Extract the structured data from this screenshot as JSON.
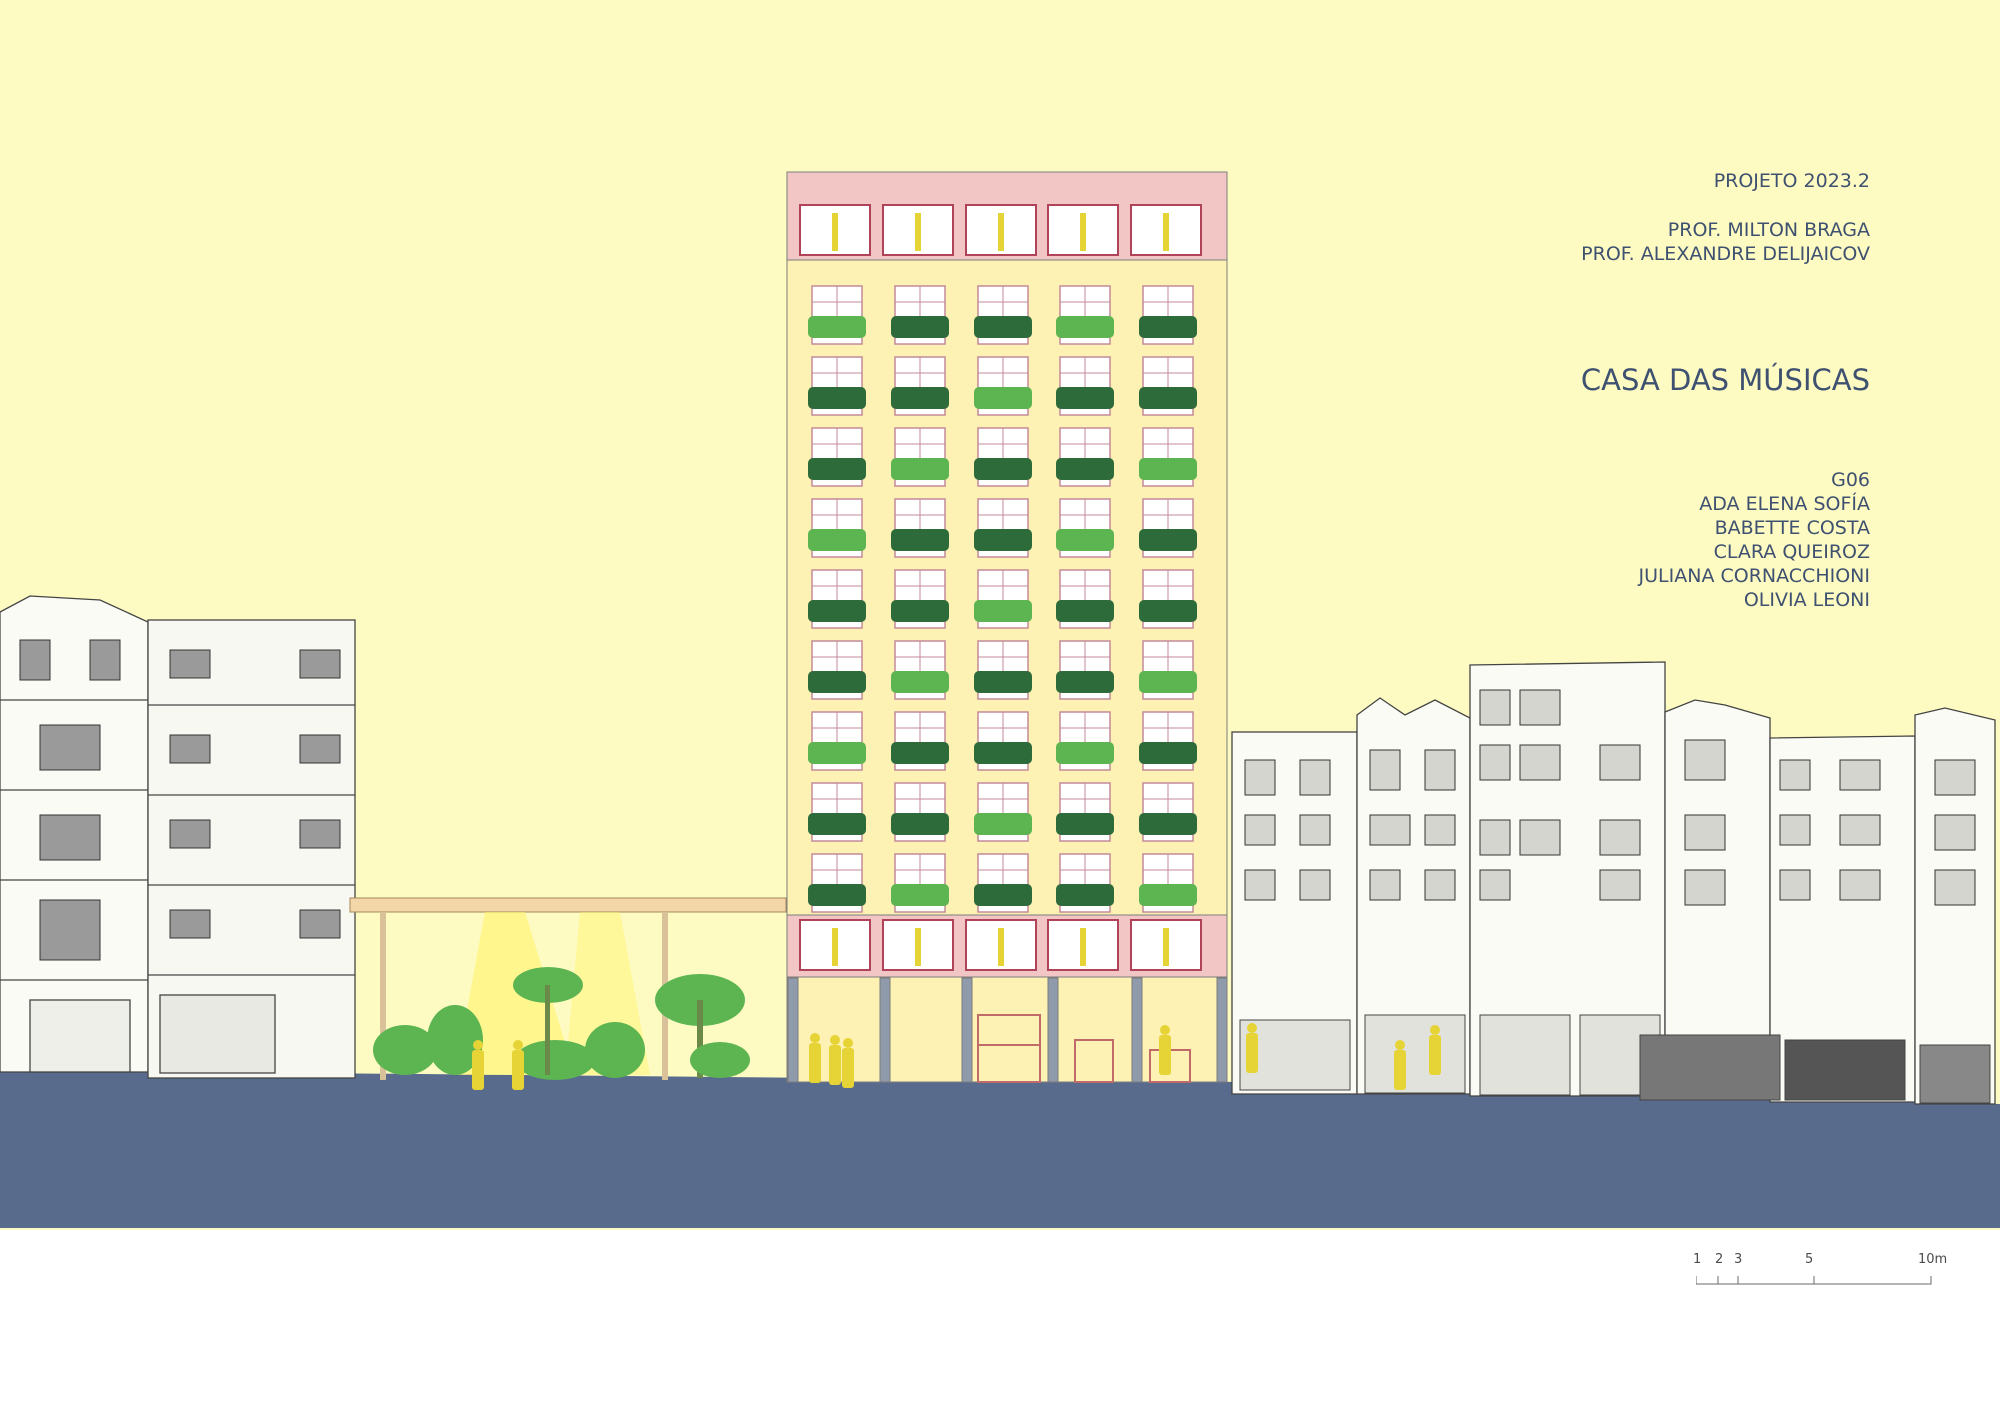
{
  "project": "PROJETO 2023.2",
  "professors": [
    "PROF. MILTON BRAGA",
    "PROF. ALEXANDRE DELIJAICOV"
  ],
  "title": "CASA DAS MÚSICAS",
  "group": "G06",
  "members": [
    "ADA ELENA SOFÍA",
    "BABETTE COSTA",
    "CLARA QUEIROZ",
    "JULIANA CORNACCHIONI",
    "OLIVIA LEONI"
  ],
  "scale_bar": [
    "1",
    "2",
    "3",
    "5",
    "10m"
  ],
  "colors": {
    "sky": "#fefbc2",
    "street": "#586b8c",
    "tower_body": "#fdf2b3",
    "tower_band": "#f3c6c6",
    "figures": "#e6d335",
    "plants_dark": "#2e6b3b",
    "plants_light": "#5db552",
    "text": "#3e5170"
  }
}
